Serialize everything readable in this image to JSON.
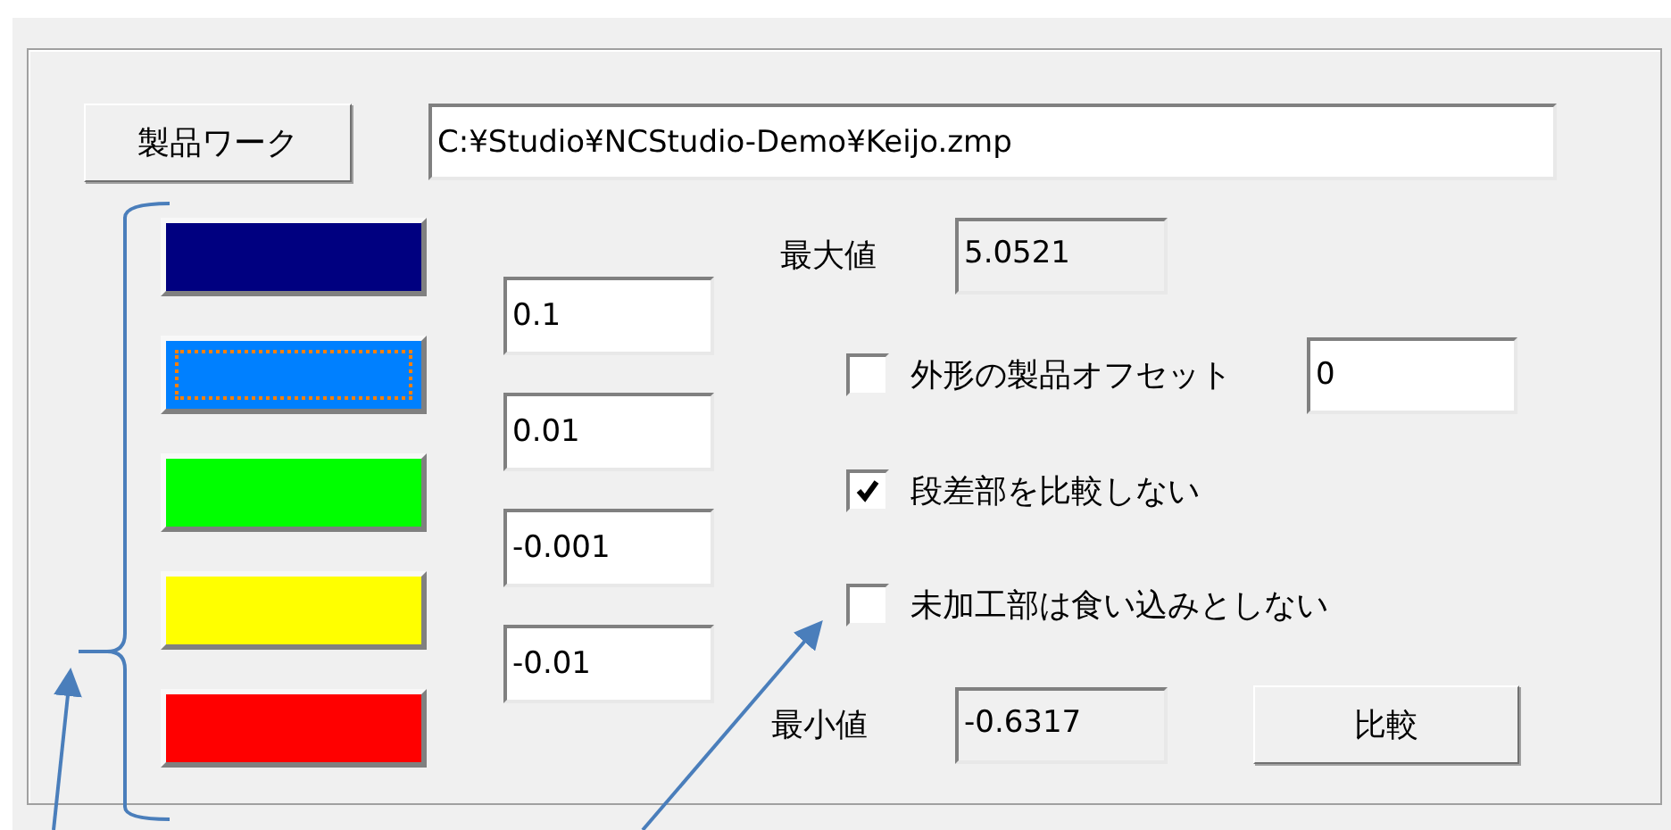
{
  "product_button": {
    "label": "製品ワーク"
  },
  "path_field": {
    "value": "C:¥Studio¥NCStudio-Demo¥Keijo.zmp"
  },
  "color_buttons": [
    {
      "color": "#000080",
      "focused": false
    },
    {
      "color": "#0080ff",
      "focused": true
    },
    {
      "color": "#00ff00",
      "focused": false
    },
    {
      "color": "#ffff00",
      "focused": false
    },
    {
      "color": "#ff0000",
      "focused": false
    }
  ],
  "thresholds": [
    {
      "value": "0.1"
    },
    {
      "value": "0.01"
    },
    {
      "value": "-0.001"
    },
    {
      "value": "-0.01"
    }
  ],
  "max": {
    "label": "最大値",
    "value": "5.0521"
  },
  "options": [
    {
      "kind": "with_field",
      "label": "外形の製品オフセット",
      "checked": false,
      "value": "0"
    },
    {
      "kind": "plain",
      "label": "段差部を比較しない",
      "checked": true
    },
    {
      "kind": "plain",
      "label": "未加工部は食い込みとしない",
      "checked": false
    }
  ],
  "min": {
    "label": "最小値",
    "value": "-0.6317"
  },
  "compare_button": {
    "label": "比較"
  }
}
